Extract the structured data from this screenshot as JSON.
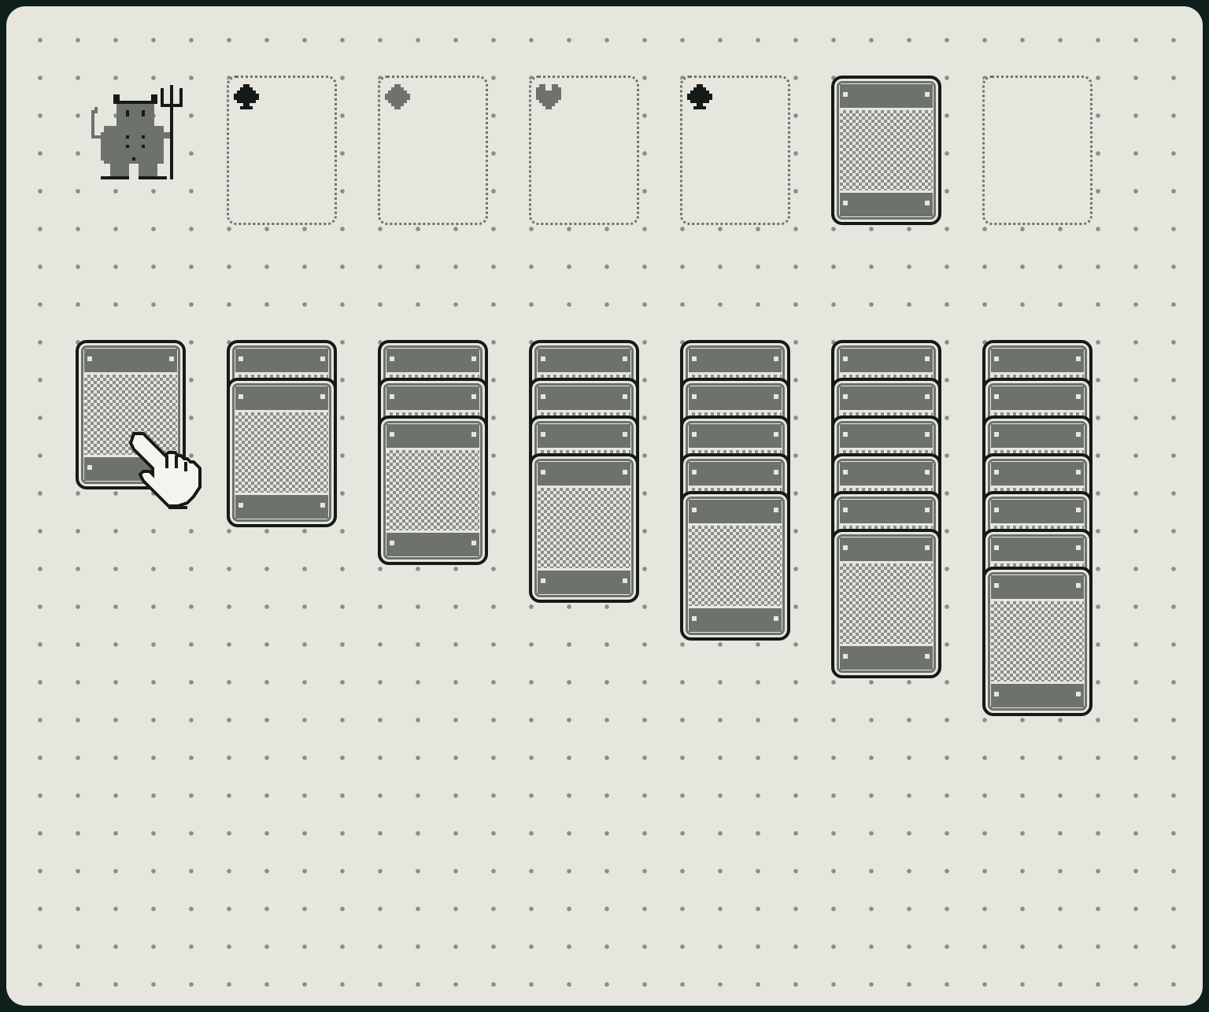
{
  "game": "solitaire",
  "theme": {
    "felt": "#e6e6df",
    "frame": "#0e1f1c",
    "card_gray": "#6e726c",
    "ink": "#141a18",
    "dot": "#8a8e87"
  },
  "mascot": {
    "icon": "devil-with-pitchfork-icon"
  },
  "foundations": [
    {
      "suit": "clubs",
      "icon": "club-icon",
      "color": "#141a18"
    },
    {
      "suit": "diamonds",
      "icon": "diamond-icon",
      "color": "#6e726c"
    },
    {
      "suit": "hearts",
      "icon": "heart-icon",
      "color": "#6e726c"
    },
    {
      "suit": "spades",
      "icon": "spade-icon",
      "color": "#141a18"
    }
  ],
  "stock": {
    "face_down_cards": 1
  },
  "waste": {
    "cards": 0
  },
  "tableau": [
    {
      "face_down_cards": 1
    },
    {
      "face_down_cards": 2
    },
    {
      "face_down_cards": 3
    },
    {
      "face_down_cards": 4
    },
    {
      "face_down_cards": 5
    },
    {
      "face_down_cards": 6
    },
    {
      "face_down_cards": 7
    }
  ],
  "cursor": {
    "icon": "pointing-hand-cursor-icon"
  }
}
